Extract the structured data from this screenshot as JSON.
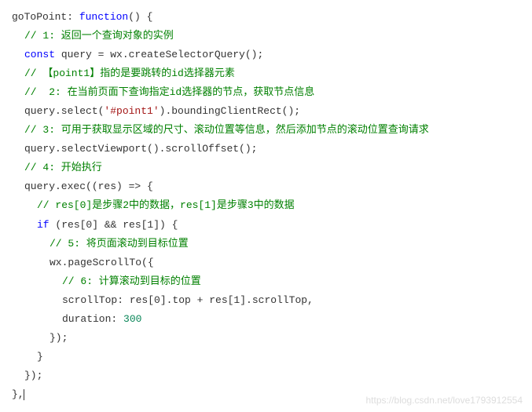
{
  "code": {
    "l1_name": "goToPoint: ",
    "l1_kw": "function",
    "l1_tail": "() {",
    "l2": "// 1: 返回一个查询对象的实例",
    "l3_kw": "const",
    "l3_rest": " query = wx.createSelectorQuery();",
    "l4": "// 【point1】指的是要跳转的id选择器元素",
    "l5": "//  2: 在当前页面下查询指定id选择器的节点，获取节点信息",
    "l6_a": "query.select(",
    "l6_str": "'#point1'",
    "l6_b": ").boundingClientRect();",
    "l7": "// 3: 可用于获取显示区域的尺寸、滚动位置等信息，然后添加节点的滚动位置查询请求",
    "l8": "query.selectViewport().scrollOffset();",
    "l9": "// 4: 开始执行",
    "l10": "query.exec((res) => {",
    "l11": "// res[0]是步骤2中的数据，res[1]是步骤3中的数据",
    "l12_kw": "if",
    "l12_rest": " (res[0] && res[1]) {",
    "l13": "// 5: 将页面滚动到目标位置",
    "l14": "wx.pageScrollTo({",
    "l15": "// 6: 计算滚动到目标的位置",
    "l16_a": "scrollTop: res[0].top + res[1].scrollTop,",
    "l17_a": "duration: ",
    "l17_num": "300",
    "l18": "});",
    "l19": "}",
    "l20": "});",
    "l21": "},"
  },
  "watermark": "https://blog.csdn.net/love1793912554"
}
